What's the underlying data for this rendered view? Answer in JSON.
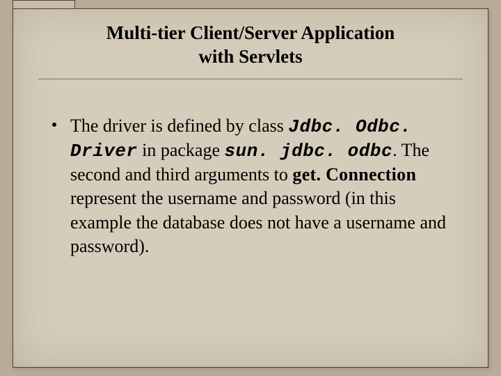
{
  "title_line1": "Multi-tier Client/Server Application",
  "title_line2": "with Servlets",
  "body": {
    "t1": "The driver is defined by class ",
    "code1": "Jdbc. Odbc. Driver",
    "t2": " in package ",
    "code2": "sun. jdbc. odbc",
    "t3": ". The second and third arguments to ",
    "code3": "get. Connection",
    "t4": " represent the username and password (in this example the database does not have a username and password)."
  }
}
